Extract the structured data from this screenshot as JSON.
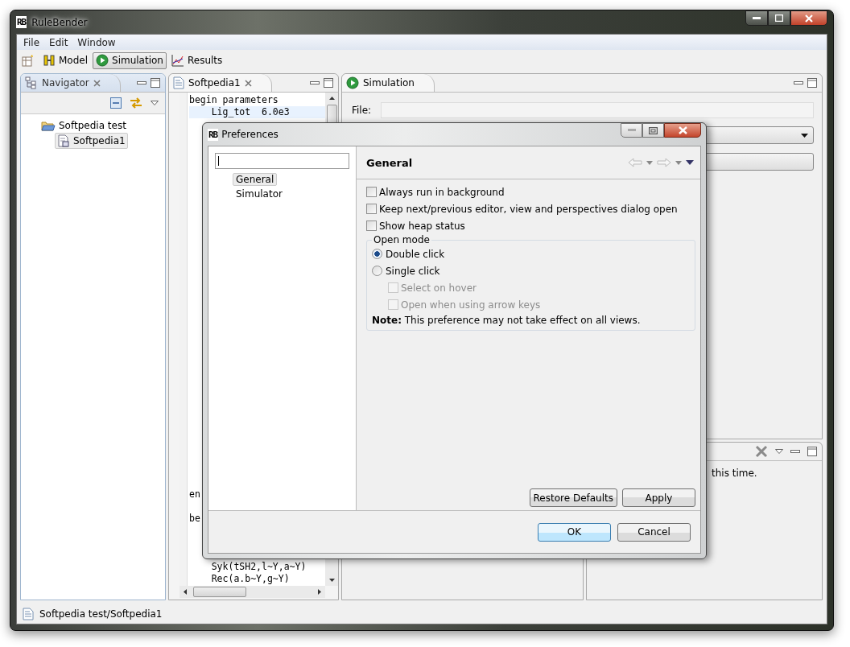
{
  "window": {
    "logo": "RB",
    "title": "RuleBender"
  },
  "menu": [
    "File",
    "Edit",
    "Window"
  ],
  "perspectives": [
    {
      "label": "Model",
      "kind": "model",
      "selected": false
    },
    {
      "label": "Simulation",
      "kind": "simulation",
      "selected": true
    },
    {
      "label": "Results",
      "kind": "results",
      "selected": false
    }
  ],
  "navigator": {
    "title": "Navigator",
    "tree": [
      {
        "label": "Softpedia test",
        "kind": "folder",
        "selected": false,
        "children": [
          {
            "label": "Softpedia1",
            "kind": "file",
            "selected": true
          }
        ]
      }
    ]
  },
  "editor": {
    "tab": "Softpedia1",
    "lines_top": [
      {
        "text": "begin parameters",
        "highlighted": false
      },
      {
        "text": "    Lig_tot  6.0e3",
        "highlighted": true
      }
    ],
    "lines_bottom": [
      {
        "text": "en",
        "highlighted": false
      },
      {
        "text": "be",
        "highlighted": false
      },
      {
        "text": "    Syk(tSH2,l~Y,a~Y)",
        "highlighted": false
      },
      {
        "text": "    Rec(a.b~Y,g~Y)",
        "highlighted": false
      }
    ]
  },
  "simulation": {
    "tab": "Simulation",
    "file_label": "File:"
  },
  "console": {
    "message": "this time."
  },
  "status_bar": {
    "text": "Softpedia test/Softpedia1"
  },
  "dialog": {
    "logo": "RB",
    "title": "Preferences",
    "pages": [
      {
        "label": "General",
        "selected": true
      },
      {
        "label": "Simulator",
        "selected": false
      }
    ],
    "page_title": "General",
    "options": [
      {
        "label": "Always run in background",
        "checked": false
      },
      {
        "label": "Keep next/previous editor, view and perspectives dialog open",
        "checked": false
      },
      {
        "label": "Show heap status",
        "checked": false
      }
    ],
    "open_mode": {
      "title": "Open mode",
      "radios": [
        {
          "label": "Double click",
          "selected": true
        },
        {
          "label": "Single click",
          "selected": false
        }
      ],
      "sub_options": [
        {
          "label": "Select on hover",
          "checked": false,
          "disabled": true
        },
        {
          "label": "Open when using arrow keys",
          "checked": false,
          "disabled": true
        }
      ],
      "note": "**Note:** This preference may not take effect on all views."
    },
    "page_buttons": [
      "Restore Defaults",
      "Apply"
    ],
    "buttons": [
      {
        "label": "OK",
        "default": true
      },
      {
        "label": "Cancel",
        "default": false
      }
    ]
  }
}
